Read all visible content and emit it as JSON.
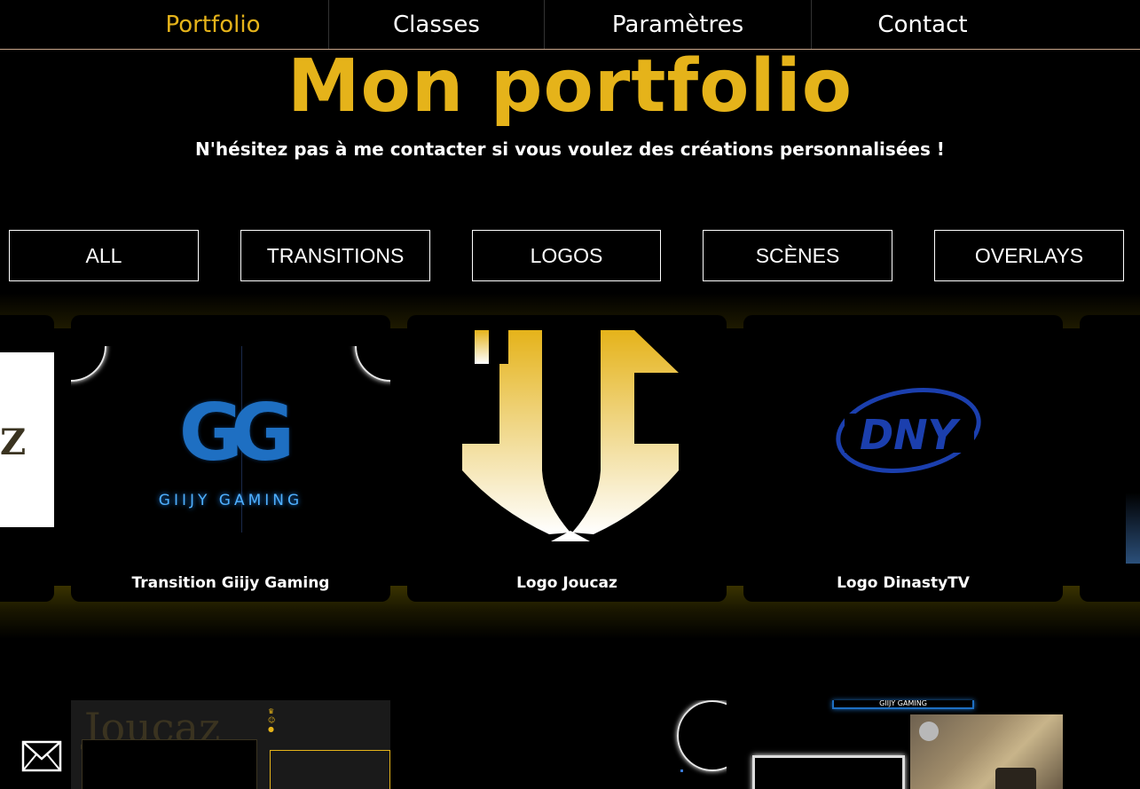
{
  "nav": {
    "items": [
      {
        "label": "Portfolio",
        "active": true
      },
      {
        "label": "Classes",
        "active": false
      },
      {
        "label": "Paramètres",
        "active": false
      },
      {
        "label": "Contact",
        "active": false
      }
    ]
  },
  "header": {
    "title": "Mon portfolio",
    "subtitle": "N'hésitez pas à me contacter si vous voulez des créations personnalisées !"
  },
  "filters": [
    "ALL",
    "TRANSITIONS",
    "LOGOS",
    "SCÈNES",
    "OVERLAYS"
  ],
  "gallery": {
    "row1": [
      {
        "title": "Transition Giijy Gaming",
        "thumb_text": "GIIJY GAMING",
        "logo_text": "GG"
      },
      {
        "title": "Logo Joucaz",
        "logo_text": "JC"
      },
      {
        "title": "Logo DinastyTV",
        "logo_text": "DNY"
      }
    ],
    "row2": {
      "joucaz_text": "Joucaz",
      "giijy_banner": "GIIJY GAMING"
    },
    "partial_left_text": "Z"
  },
  "colors": {
    "accent": "#e5b31a",
    "background": "#000000",
    "giijy_blue": "#1e6fc2",
    "dny_blue": "#1b3fae"
  },
  "contact_icon": "mail-icon"
}
